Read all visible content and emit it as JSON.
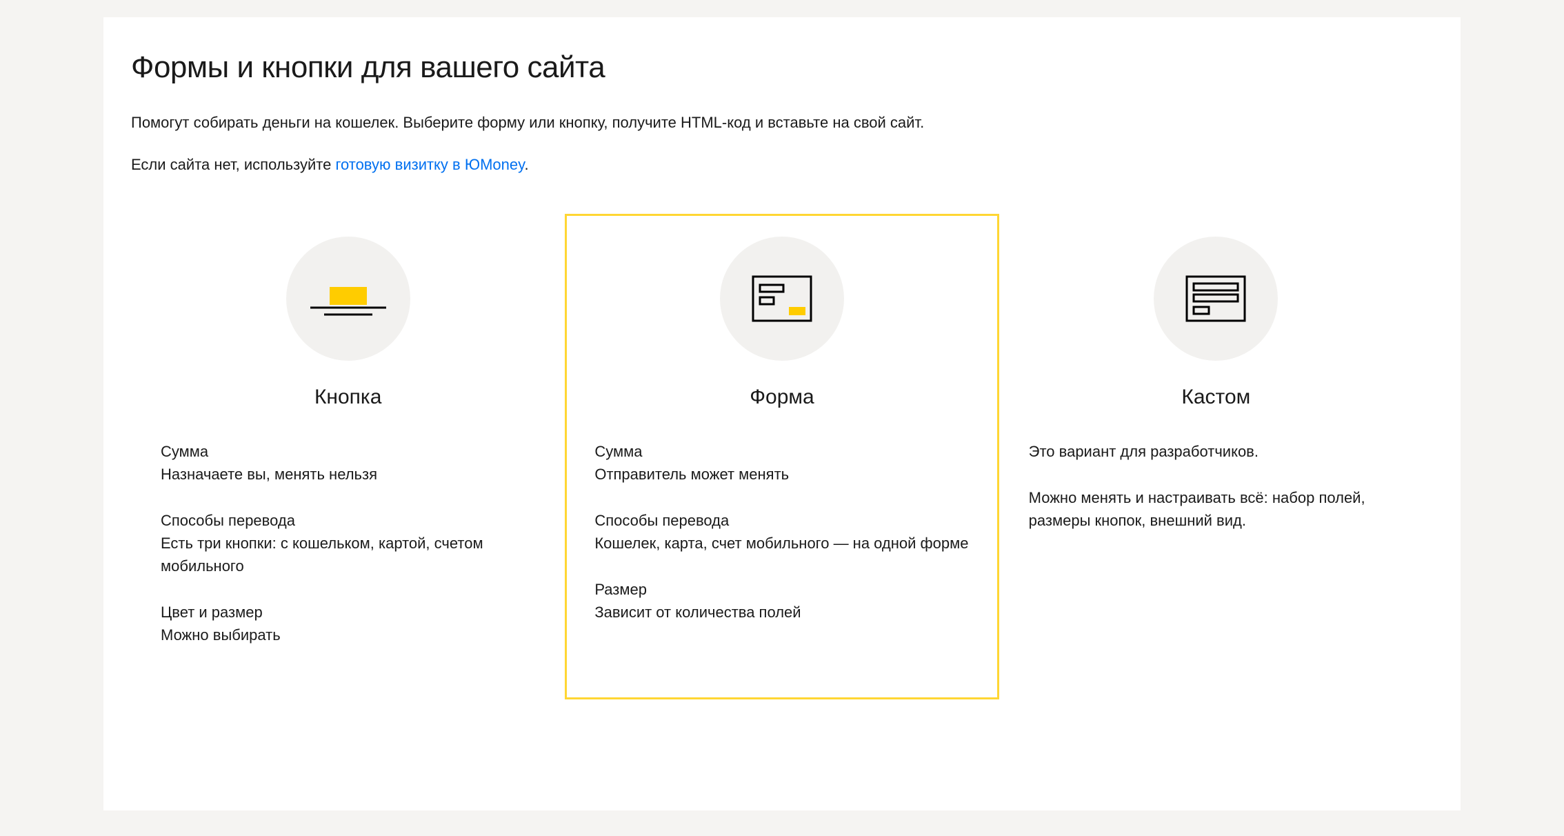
{
  "title": "Формы и кнопки для вашего сайта",
  "intro1": "Помогут собирать деньги на кошелек. Выберите форму или кнопку, получите HTML-код и вставьте на свой сайт.",
  "intro2_prefix": "Если сайта нет, используйте ",
  "intro2_link": "готовую визитку в ЮMoney",
  "intro2_suffix": ".",
  "options": {
    "button": {
      "title": "Кнопка",
      "features": [
        {
          "label": "Сумма",
          "value": "Назначаете вы, менять нельзя"
        },
        {
          "label": "Способы перевода",
          "value": "Есть три кнопки: с кошельком, картой, счетом мобильного"
        },
        {
          "label": "Цвет и размер",
          "value": "Можно выбирать"
        }
      ]
    },
    "form": {
      "title": "Форма",
      "features": [
        {
          "label": "Сумма",
          "value": "Отправитель может менять"
        },
        {
          "label": "Способы перевода",
          "value": "Кошелек, карта, счет мобильного — на одной форме"
        },
        {
          "label": "Размер",
          "value": "Зависит от количества полей"
        }
      ]
    },
    "custom": {
      "title": "Кастом",
      "paragraph1": "Это вариант для разработчиков.",
      "paragraph2": "Можно менять и настраивать всё: набор полей, размеры кнопок, внешний вид."
    }
  }
}
